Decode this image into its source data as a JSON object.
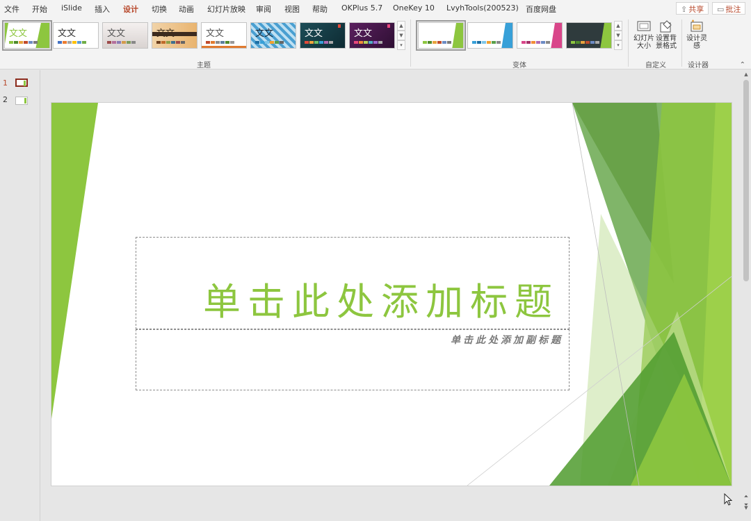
{
  "menu": {
    "items": [
      "文件",
      "开始",
      "iSlide",
      "插入",
      "设计",
      "切换",
      "动画",
      "幻灯片放映",
      "审阅",
      "视图",
      "帮助",
      "OKPlus 5.7",
      "OneKey 10",
      "LvyhTools(200523)",
      "百度网盘"
    ],
    "active": "设计",
    "share_label": "共享",
    "comments_label": "批注"
  },
  "ribbon": {
    "theme_thumb_text": "文文",
    "groups": {
      "themes_label": "主题",
      "variants_label": "变体",
      "customize_label": "自定义",
      "designer_label": "设计器"
    },
    "buttons": {
      "slide_size": "幻灯片大小",
      "format_background": "设置背景格式",
      "design_ideas": "设计灵感"
    }
  },
  "slides_panel": {
    "slide_numbers": [
      "1",
      "2"
    ],
    "active_slide": "1"
  },
  "slide": {
    "title_placeholder": "单击此处添加标题",
    "subtitle_placeholder": "单击此处添加副标题"
  },
  "colors": {
    "accent_green": "#8dc63f",
    "mid_green": "#6aa84f",
    "dark_green": "#4f8a2b",
    "office_red": "#b7472a",
    "subtitle_gray": "#7a7a7a"
  }
}
